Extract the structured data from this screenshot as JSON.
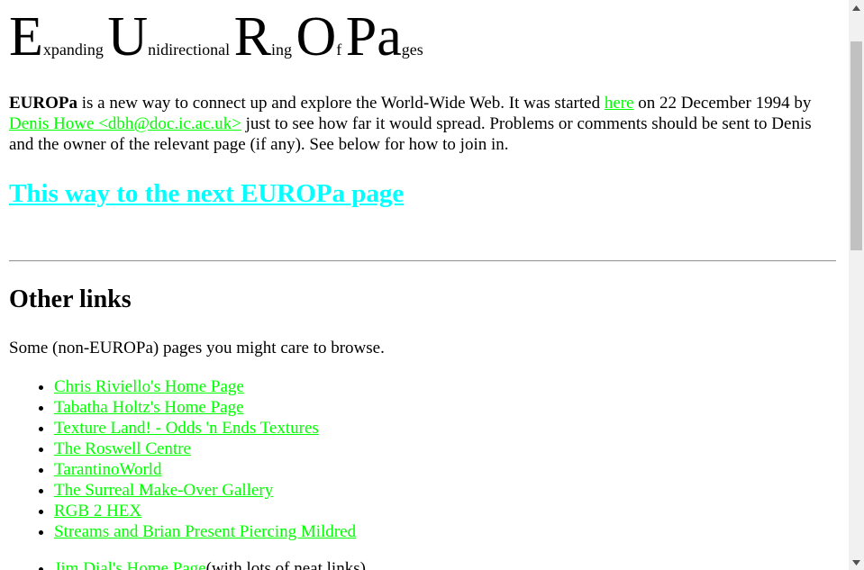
{
  "title": {
    "parts": [
      {
        "big": "E",
        "small": "xpanding "
      },
      {
        "big": "U",
        "small": "nidirectional "
      },
      {
        "big": "R",
        "small": "ing "
      },
      {
        "big": "O",
        "small": "f "
      },
      {
        "big": "Pa",
        "small": "ges"
      }
    ]
  },
  "intro": {
    "bold": "EUROPa",
    "text1": " is a new way to connect up and explore the World-Wide Web. It was started ",
    "here_link": "here",
    "text2": " on 22 December 1994 by ",
    "author_link": "Denis Howe <dbh@doc.ic.ac.uk>",
    "text3": " just to see how far it would spread. Problems or comments should be sent to Denis and the owner of the relevant page (if any). See below for how to join in."
  },
  "next_link": "This way to the next EUROPa page",
  "other": {
    "heading": "Other links",
    "description": "Some (non-EUROPa) pages you might care to browse.",
    "links": [
      "Chris Riviello's Home Page",
      "Tabatha Holtz's Home Page",
      "Texture Land! - Odds 'n Ends Textures",
      "The Roswell Centre",
      "TarantinoWorld",
      "The Surreal Make-Over Gallery",
      "RGB 2 HEX",
      "Streams and Brian Present Piercing Mildred"
    ],
    "partial_link": "Jim Dial's Home Page",
    "partial_text": "(with lots of neat links)"
  },
  "colors": {
    "link_green": "#00ff00",
    "link_cyan": "#00ffff"
  },
  "icons": {
    "scroll_up": "triangle-up-icon",
    "scroll_down": "triangle-down-icon"
  }
}
